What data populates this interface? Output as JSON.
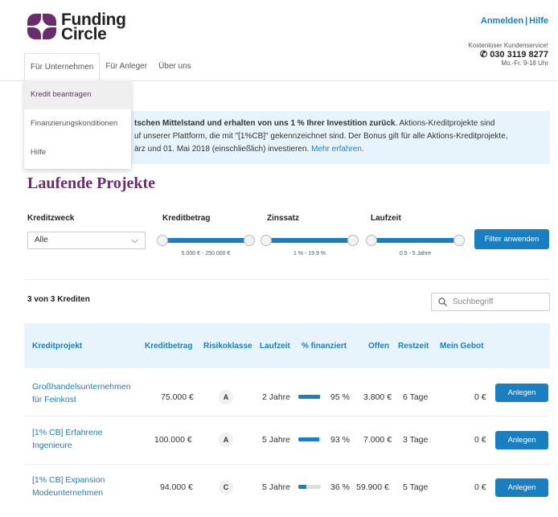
{
  "brand": {
    "name_line1": "Funding",
    "name_line2": "Circle",
    "color": "#6b2c6e"
  },
  "toplinks": {
    "login": "Anmelden",
    "separator": "|",
    "help": "Hilfe"
  },
  "service": {
    "label": "Kostenloser Kundenservice!",
    "phone": "030 3119 8277",
    "hours": "Mo.-Fr. 9-18 Uhr"
  },
  "nav": {
    "items": [
      "Für Unternehmen",
      "Für Anleger",
      "Über uns"
    ]
  },
  "dropdown": {
    "items": [
      "Kredit beantragen",
      "Finanzierungskonditionen",
      "Hilfe"
    ]
  },
  "banner": {
    "bold": "tschen Mittelstand und erhalten von uns 1 % Ihrer Investition zurück",
    "text1": ". Aktions-Kreditprojekte sind",
    "text2": "uf unserer Plattform, die mit \"[1%CB]\" gekennzeichnet sind. Der Bonus gilt für alle Aktions-Kreditprojekte,",
    "text3": "ärz und 01. Mai 2018 (einschließlich) investieren. ",
    "link": "Mehr erfahren."
  },
  "title": "Laufende Projekte",
  "filters": {
    "purpose_label": "Kreditzweck",
    "purpose_value": "Alle",
    "amount_label": "Kreditbetrag",
    "amount_range": "5.000 € - 250.000 €",
    "amount_fill": [
      0,
      1
    ],
    "rate_label": "Zinssatz",
    "rate_range": "1 % - 19.9 %",
    "rate_fill": [
      0,
      1
    ],
    "term_label": "Laufzeit",
    "term_range": "0.5 - 5 Jahre",
    "term_fill": [
      0,
      1
    ],
    "apply": "Filter anwenden"
  },
  "count": "3 von 3 Krediten",
  "search": {
    "placeholder": "Suchbegriff"
  },
  "table": {
    "headers": [
      "Kreditprojekt",
      "Kreditbetrag",
      "Risikoklasse",
      "Laufzeit",
      "% finanziert",
      "Offen",
      "Restzeit",
      "Mein Gebot"
    ],
    "rows": [
      {
        "name1": "Großhandelsunternehmen",
        "name2": "für Feinkost",
        "amount": "75.000 €",
        "risk": "A",
        "term": "2 Jahre",
        "funded": 95,
        "funded_label": "95 %",
        "open": "3.800 €",
        "rest": "6 Tage",
        "bid": "0 €",
        "action": "Anlegen"
      },
      {
        "name1": "[1% CB] Erfahrene",
        "name2": "Ingenieure",
        "amount": "100.000 €",
        "risk": "A",
        "term": "5 Jahre",
        "funded": 93,
        "funded_label": "93 %",
        "open": "7.000 €",
        "rest": "3 Tage",
        "bid": "0 €",
        "action": "Anlegen"
      },
      {
        "name1": "[1% CB] Expansion",
        "name2": "Modeunternehmen",
        "amount": "94.000 €",
        "risk": "C",
        "term": "5 Jahre",
        "funded": 36,
        "funded_label": "36 %",
        "open": "59.900 €",
        "rest": "5 Tage",
        "bid": "0 €",
        "action": "Anlegen"
      }
    ]
  },
  "accent": "#1a7fc1"
}
